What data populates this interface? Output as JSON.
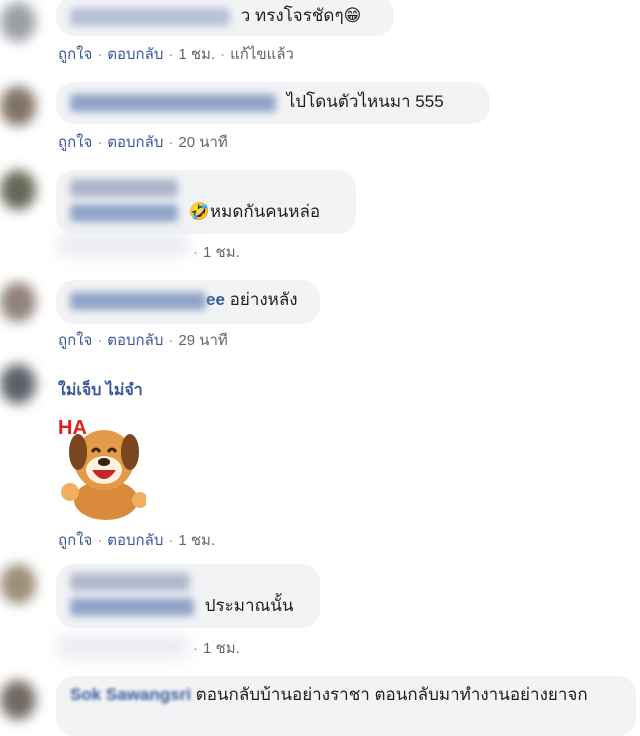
{
  "comments": [
    {
      "text": "ว ทรงโจรชัดๆ😁",
      "actions": {
        "like": "ถูกใจ",
        "reply": "ตอบกลับ",
        "time": "1 ชม.",
        "edited": "แก้ไขแล้ว"
      }
    },
    {
      "text": "ไปโดนตัวไหนมา 555",
      "actions": {
        "like": "ถูกใจ",
        "reply": "ตอบกลับ",
        "time": "20 นาที"
      }
    },
    {
      "text": "🤣หมดกันคนหล่อ",
      "actions": {
        "time": "1 ชม."
      }
    },
    {
      "name_tail": "ee",
      "text": "อย่างหลัง",
      "actions": {
        "like": "ถูกใจ",
        "reply": "ตอบกลับ",
        "time": "29 นาที"
      }
    },
    {
      "name": "ใม่เจ็บ ไม่จำ",
      "sticker": "laughing-dog-sticker",
      "actions": {
        "like": "ถูกใจ",
        "reply": "ตอบกลับ",
        "time": "1 ชม."
      }
    },
    {
      "text": "ประมาณนั้น",
      "actions": {
        "time": "1 ชม."
      }
    },
    {
      "name": "Sok Sawangsri",
      "text": "ตอนกลับบ้านอย่างราชา ตอนกลับมาทำงานอย่างยาจก"
    }
  ],
  "colors": {
    "bubble": "#f2f3f5",
    "link": "#385898",
    "meta": "#606770"
  }
}
